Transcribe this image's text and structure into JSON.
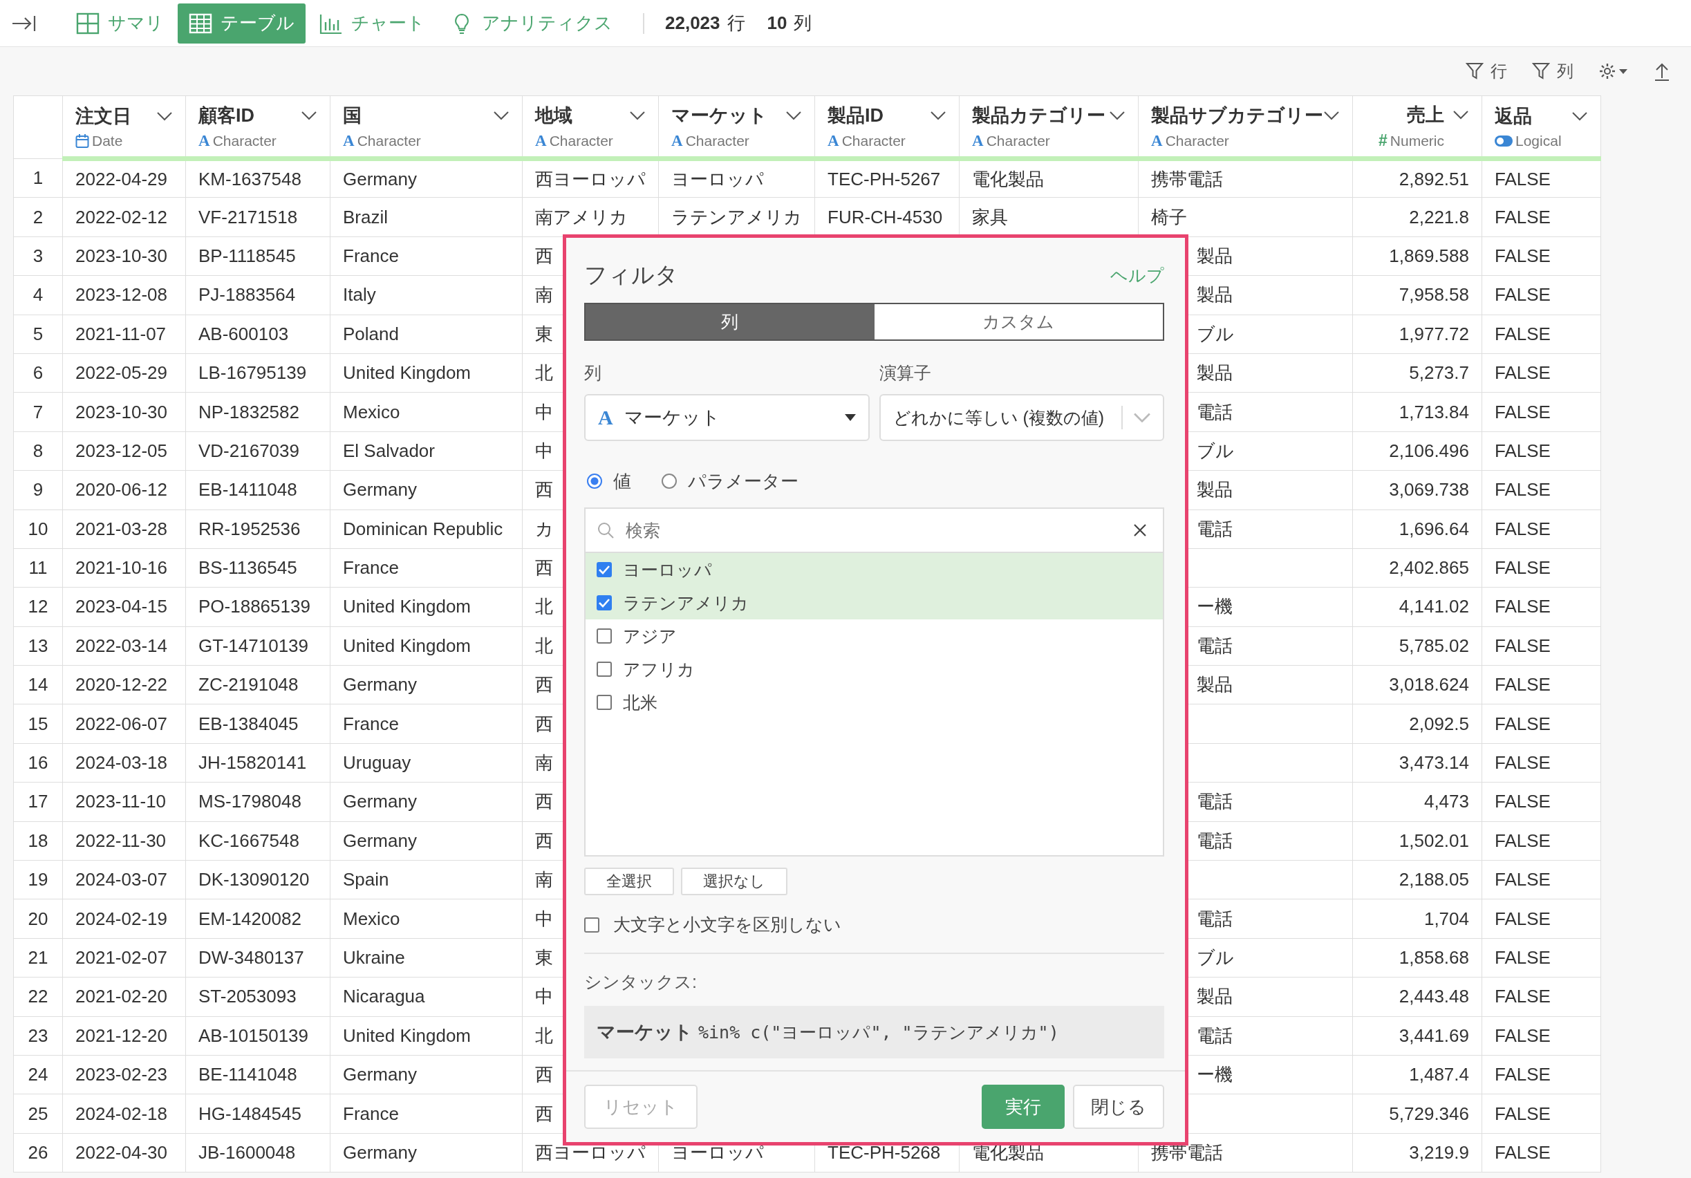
{
  "top_bar": {
    "views": [
      {
        "label": "サマリ",
        "kind": "summary",
        "selected": false
      },
      {
        "label": "テーブル",
        "kind": "table",
        "selected": true
      },
      {
        "label": "チャート",
        "kind": "chart",
        "selected": false
      },
      {
        "label": "アナリティクス",
        "kind": "analytics",
        "selected": false
      }
    ],
    "stats": [
      {
        "value": "22,023",
        "unit": "行"
      },
      {
        "value": "10",
        "unit": "列"
      }
    ]
  },
  "toolbar": {
    "row_filter": "行",
    "column_filter": "列"
  },
  "table": {
    "columns": [
      {
        "name": "注文日",
        "type": "Date",
        "kind": "date"
      },
      {
        "name": "顧客ID",
        "type": "Character",
        "kind": "character",
        "icon": "A"
      },
      {
        "name": "国",
        "type": "Character",
        "kind": "character",
        "icon": "A"
      },
      {
        "name": "地域",
        "type": "Character",
        "kind": "character",
        "icon": "A"
      },
      {
        "name": "マーケット",
        "type": "Character",
        "kind": "character",
        "icon": "A"
      },
      {
        "name": "製品ID",
        "type": "Character",
        "kind": "character",
        "icon": "A"
      },
      {
        "name": "製品カテゴリー",
        "type": "Character",
        "kind": "character",
        "icon": "A"
      },
      {
        "name": "製品サブカテゴリー",
        "type": "Character",
        "kind": "character",
        "icon": "A"
      },
      {
        "name": "売上",
        "type": "Numeric",
        "kind": "numeric",
        "icon": "#"
      },
      {
        "name": "返品",
        "type": "Logical",
        "kind": "logical"
      }
    ],
    "rows": [
      {
        "number": "1",
        "cells": [
          "2022-04-29",
          "KM-1637548",
          "Germany",
          "西ヨーロッパ",
          "ヨーロッパ",
          "TEC-PH-5267",
          "電化製品",
          "携帯電話",
          "2,892.51",
          "FALSE"
        ]
      },
      {
        "number": "2",
        "cells": [
          "2022-02-12",
          "VF-2171518",
          "Brazil",
          "南アメリカ",
          "ラテンアメリカ",
          "FUR-CH-4530",
          "家具",
          "椅子",
          "2,221.8",
          "FALSE"
        ]
      },
      {
        "number": "3",
        "cells": [
          "2023-10-30",
          "BP-1118545",
          "France",
          "西",
          null,
          null,
          null,
          {
            "text": "製品",
            "clipped_left": true
          },
          "1,869.588",
          "FALSE"
        ]
      },
      {
        "number": "4",
        "cells": [
          "2023-12-08",
          "PJ-1883564",
          "Italy",
          "南",
          null,
          null,
          null,
          {
            "text": "製品",
            "clipped_left": true
          },
          "7,958.58",
          "FALSE"
        ]
      },
      {
        "number": "5",
        "cells": [
          "2021-11-07",
          "AB-600103",
          "Poland",
          "東",
          null,
          null,
          null,
          {
            "text": "ブル",
            "clipped_left": true
          },
          "1,977.72",
          "FALSE"
        ]
      },
      {
        "number": "6",
        "cells": [
          "2022-05-29",
          "LB-16795139",
          "United Kingdom",
          "北",
          null,
          null,
          null,
          {
            "text": "製品",
            "clipped_left": true
          },
          "5,273.7",
          "FALSE"
        ]
      },
      {
        "number": "7",
        "cells": [
          "2023-10-30",
          "NP-1832582",
          "Mexico",
          "中",
          null,
          null,
          null,
          {
            "text": "電話",
            "clipped_left": true
          },
          "1,713.84",
          "FALSE"
        ]
      },
      {
        "number": "8",
        "cells": [
          "2023-12-05",
          "VD-2167039",
          "El Salvador",
          "中",
          null,
          null,
          null,
          {
            "text": "ブル",
            "clipped_left": true
          },
          "2,106.496",
          "FALSE"
        ]
      },
      {
        "number": "9",
        "cells": [
          "2020-06-12",
          "EB-1411048",
          "Germany",
          "西",
          null,
          null,
          null,
          {
            "text": "製品",
            "clipped_left": true
          },
          "3,069.738",
          "FALSE"
        ]
      },
      {
        "number": "10",
        "cells": [
          "2021-03-28",
          "RR-1952536",
          "Dominican Republic",
          "カ",
          null,
          null,
          null,
          {
            "text": "電話",
            "clipped_left": true
          },
          "1,696.64",
          "FALSE"
        ]
      },
      {
        "number": "11",
        "cells": [
          "2021-10-16",
          "BS-1136545",
          "France",
          "西",
          null,
          null,
          null,
          null,
          "2,402.865",
          "FALSE"
        ]
      },
      {
        "number": "12",
        "cells": [
          "2023-04-15",
          "PO-18865139",
          "United Kingdom",
          "北",
          null,
          null,
          null,
          {
            "text": "ー機",
            "clipped_left": true
          },
          "4,141.02",
          "FALSE"
        ]
      },
      {
        "number": "13",
        "cells": [
          "2022-03-14",
          "GT-14710139",
          "United Kingdom",
          "北",
          null,
          null,
          null,
          {
            "text": "電話",
            "clipped_left": true
          },
          "5,785.02",
          "FALSE"
        ]
      },
      {
        "number": "14",
        "cells": [
          "2020-12-22",
          "ZC-2191048",
          "Germany",
          "西",
          null,
          null,
          null,
          {
            "text": "製品",
            "clipped_left": true
          },
          "3,018.624",
          "FALSE"
        ]
      },
      {
        "number": "15",
        "cells": [
          "2022-06-07",
          "EB-1384045",
          "France",
          "西",
          null,
          null,
          null,
          null,
          "2,092.5",
          "FALSE"
        ]
      },
      {
        "number": "16",
        "cells": [
          "2024-03-18",
          "JH-15820141",
          "Uruguay",
          "南",
          null,
          null,
          null,
          null,
          "3,473.14",
          "FALSE"
        ]
      },
      {
        "number": "17",
        "cells": [
          "2023-11-10",
          "MS-1798048",
          "Germany",
          "西",
          null,
          null,
          null,
          {
            "text": "電話",
            "clipped_left": true
          },
          "4,473",
          "FALSE"
        ]
      },
      {
        "number": "18",
        "cells": [
          "2022-11-30",
          "KC-1667548",
          "Germany",
          "西",
          null,
          null,
          null,
          {
            "text": "電話",
            "clipped_left": true
          },
          "1,502.01",
          "FALSE"
        ]
      },
      {
        "number": "19",
        "cells": [
          "2024-03-07",
          "DK-13090120",
          "Spain",
          "南",
          null,
          null,
          null,
          null,
          "2,188.05",
          "FALSE"
        ]
      },
      {
        "number": "20",
        "cells": [
          "2024-02-19",
          "EM-1420082",
          "Mexico",
          "中",
          null,
          null,
          null,
          {
            "text": "電話",
            "clipped_left": true
          },
          "1,704",
          "FALSE"
        ]
      },
      {
        "number": "21",
        "cells": [
          "2021-02-07",
          "DW-3480137",
          "Ukraine",
          "東",
          null,
          null,
          null,
          {
            "text": "ブル",
            "clipped_left": true
          },
          "1,858.68",
          "FALSE"
        ]
      },
      {
        "number": "22",
        "cells": [
          "2021-02-20",
          "ST-2053093",
          "Nicaragua",
          "中",
          null,
          null,
          null,
          {
            "text": "製品",
            "clipped_left": true
          },
          "2,443.48",
          "FALSE"
        ]
      },
      {
        "number": "23",
        "cells": [
          "2021-12-20",
          "AB-10150139",
          "United Kingdom",
          "北",
          null,
          null,
          null,
          {
            "text": "電話",
            "clipped_left": true
          },
          "3,441.69",
          "FALSE"
        ]
      },
      {
        "number": "24",
        "cells": [
          "2023-02-23",
          "BE-1141048",
          "Germany",
          "西",
          null,
          null,
          null,
          {
            "text": "ー機",
            "clipped_left": true
          },
          "1,487.4",
          "FALSE"
        ]
      },
      {
        "number": "25",
        "cells": [
          "2024-02-18",
          "HG-1484545",
          "France",
          "西",
          null,
          null,
          null,
          null,
          "5,729.346",
          "FALSE"
        ]
      },
      {
        "number": "26",
        "cells": [
          "2022-04-30",
          "JB-1600048",
          "Germany",
          "西ヨーロッパ",
          "ヨーロッパ",
          "TEC-PH-5268",
          "電化製品",
          "携帯電話",
          "3,219.9",
          "FALSE"
        ]
      }
    ]
  },
  "filter_dialog": {
    "title": "フィルタ",
    "help_link": "ヘルプ",
    "tabs": [
      {
        "label": "列",
        "selected": true
      },
      {
        "label": "カスタム",
        "selected": false
      }
    ],
    "column_label": "列",
    "column_select": {
      "icon": "A",
      "value": "マーケット"
    },
    "operator_label": "演算子",
    "operator_select": {
      "value": "どれかに等しい (複数の値)"
    },
    "mode_options": [
      {
        "label": "値",
        "selected": true
      },
      {
        "label": "パラメーター",
        "selected": false
      }
    ],
    "search": {
      "placeholder": "検索"
    },
    "values": [
      {
        "label": "ヨーロッパ",
        "checked": true
      },
      {
        "label": "ラテンアメリカ",
        "checked": true
      },
      {
        "label": "アジア",
        "checked": false
      },
      {
        "label": "アフリカ",
        "checked": false
      },
      {
        "label": "北米",
        "checked": false
      }
    ],
    "select_all_button": "全選択",
    "select_none_button": "選択なし",
    "ignore_case": {
      "label": "大文字と小文字を区別しない",
      "checked": false
    },
    "syntax_label": "シンタックス:",
    "syntax": "**マーケット** %in% c(\"ヨーロッパ\", \"ラテンアメリカ\")",
    "reset_button": {
      "label": "リセット",
      "disabled": true
    },
    "run_button": "実行",
    "close_button": "閉じる"
  }
}
